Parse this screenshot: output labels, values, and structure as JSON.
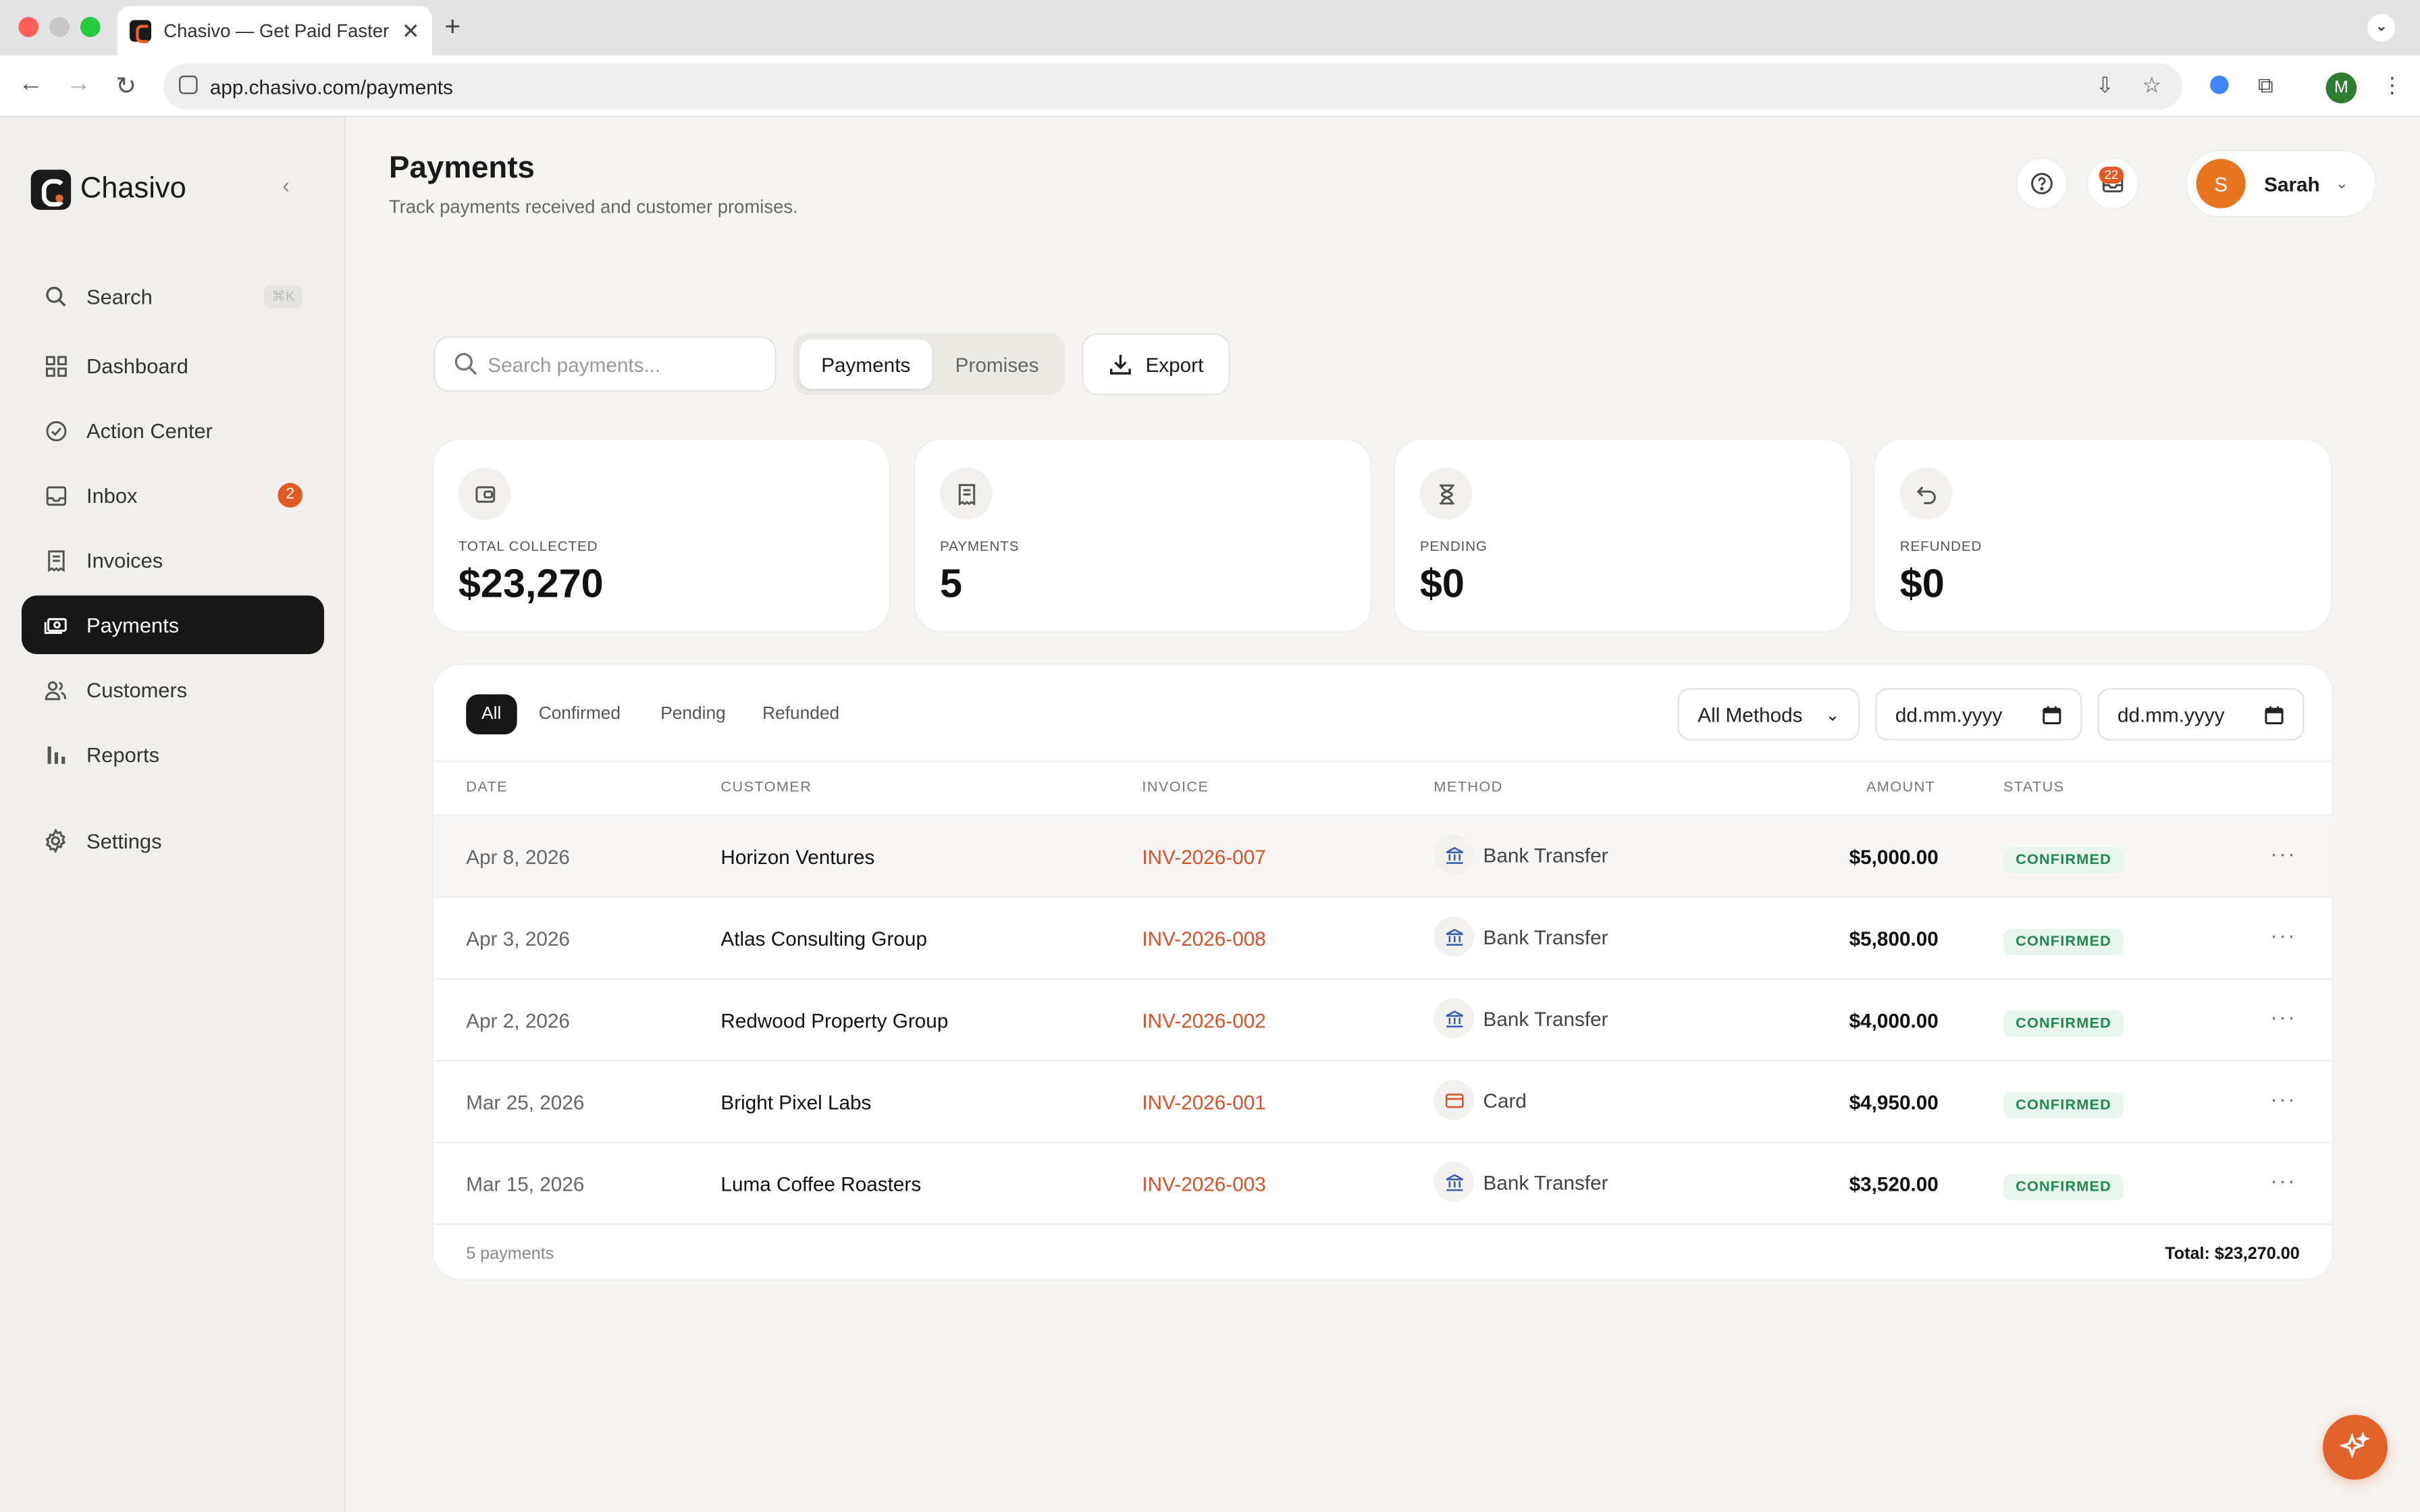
{
  "browser": {
    "tab_title": "Chasivo — Get Paid Faster",
    "url": "app.chasivo.com/payments",
    "profile_initial": "M"
  },
  "sidebar": {
    "brand": "Chasivo",
    "search_label": "Search",
    "search_shortcut": "⌘K",
    "items": [
      {
        "label": "Dashboard",
        "icon": "grid-icon"
      },
      {
        "label": "Action Center",
        "icon": "check-circle-icon"
      },
      {
        "label": "Inbox",
        "icon": "inbox-icon",
        "badge": "2"
      },
      {
        "label": "Invoices",
        "icon": "receipt-icon"
      },
      {
        "label": "Payments",
        "icon": "money-icon",
        "active": true
      },
      {
        "label": "Customers",
        "icon": "users-icon"
      },
      {
        "label": "Reports",
        "icon": "bar-chart-icon"
      },
      {
        "label": "Settings",
        "icon": "gear-icon"
      }
    ]
  },
  "header": {
    "title": "Payments",
    "subtitle": "Track payments received and customer promises.",
    "notification_count": "22",
    "user_initial": "S",
    "user_name": "Sarah"
  },
  "toolbar": {
    "search_placeholder": "Search payments...",
    "tabs": [
      "Payments",
      "Promises"
    ],
    "active_tab": "Payments",
    "export_label": "Export"
  },
  "stats": [
    {
      "label": "TOTAL COLLECTED",
      "value": "$23,270",
      "icon": "wallet-icon"
    },
    {
      "label": "PAYMENTS",
      "value": "5",
      "icon": "receipt-icon"
    },
    {
      "label": "PENDING",
      "value": "$0",
      "icon": "hourglass-icon"
    },
    {
      "label": "REFUNDED",
      "value": "$0",
      "icon": "undo-icon"
    }
  ],
  "filters": {
    "status_tabs": [
      "All",
      "Confirmed",
      "Pending",
      "Refunded"
    ],
    "active_status": "All",
    "method_select": "All Methods",
    "date_from_placeholder": "dd.mm.yyyy",
    "date_to_placeholder": "dd.mm.yyyy"
  },
  "table": {
    "columns": [
      "DATE",
      "CUSTOMER",
      "INVOICE",
      "METHOD",
      "AMOUNT",
      "STATUS"
    ],
    "rows": [
      {
        "date": "Apr 8, 2026",
        "customer": "Horizon Ventures",
        "invoice": "INV-2026-007",
        "method": "Bank Transfer",
        "method_icon": "bank-icon",
        "amount": "$5,000.00",
        "status": "CONFIRMED"
      },
      {
        "date": "Apr 3, 2026",
        "customer": "Atlas Consulting Group",
        "invoice": "INV-2026-008",
        "method": "Bank Transfer",
        "method_icon": "bank-icon",
        "amount": "$5,800.00",
        "status": "CONFIRMED"
      },
      {
        "date": "Apr 2, 2026",
        "customer": "Redwood Property Group",
        "invoice": "INV-2026-002",
        "method": "Bank Transfer",
        "method_icon": "bank-icon",
        "amount": "$4,000.00",
        "status": "CONFIRMED"
      },
      {
        "date": "Mar 25, 2026",
        "customer": "Bright Pixel Labs",
        "invoice": "INV-2026-001",
        "method": "Card",
        "method_icon": "card-icon",
        "amount": "$4,950.00",
        "status": "CONFIRMED"
      },
      {
        "date": "Mar 15, 2026",
        "customer": "Luma Coffee Roasters",
        "invoice": "INV-2026-003",
        "method": "Bank Transfer",
        "method_icon": "bank-icon",
        "amount": "$3,520.00",
        "status": "CONFIRMED"
      }
    ],
    "footer_count": "5 payments",
    "footer_total": "Total: $23,270.00"
  },
  "colors": {
    "accent": "#e2622b",
    "invoice_link": "#d4532a",
    "confirmed_text": "#1f8a4c",
    "confirmed_bg": "#e9f6ee",
    "active_nav": "#171717"
  }
}
